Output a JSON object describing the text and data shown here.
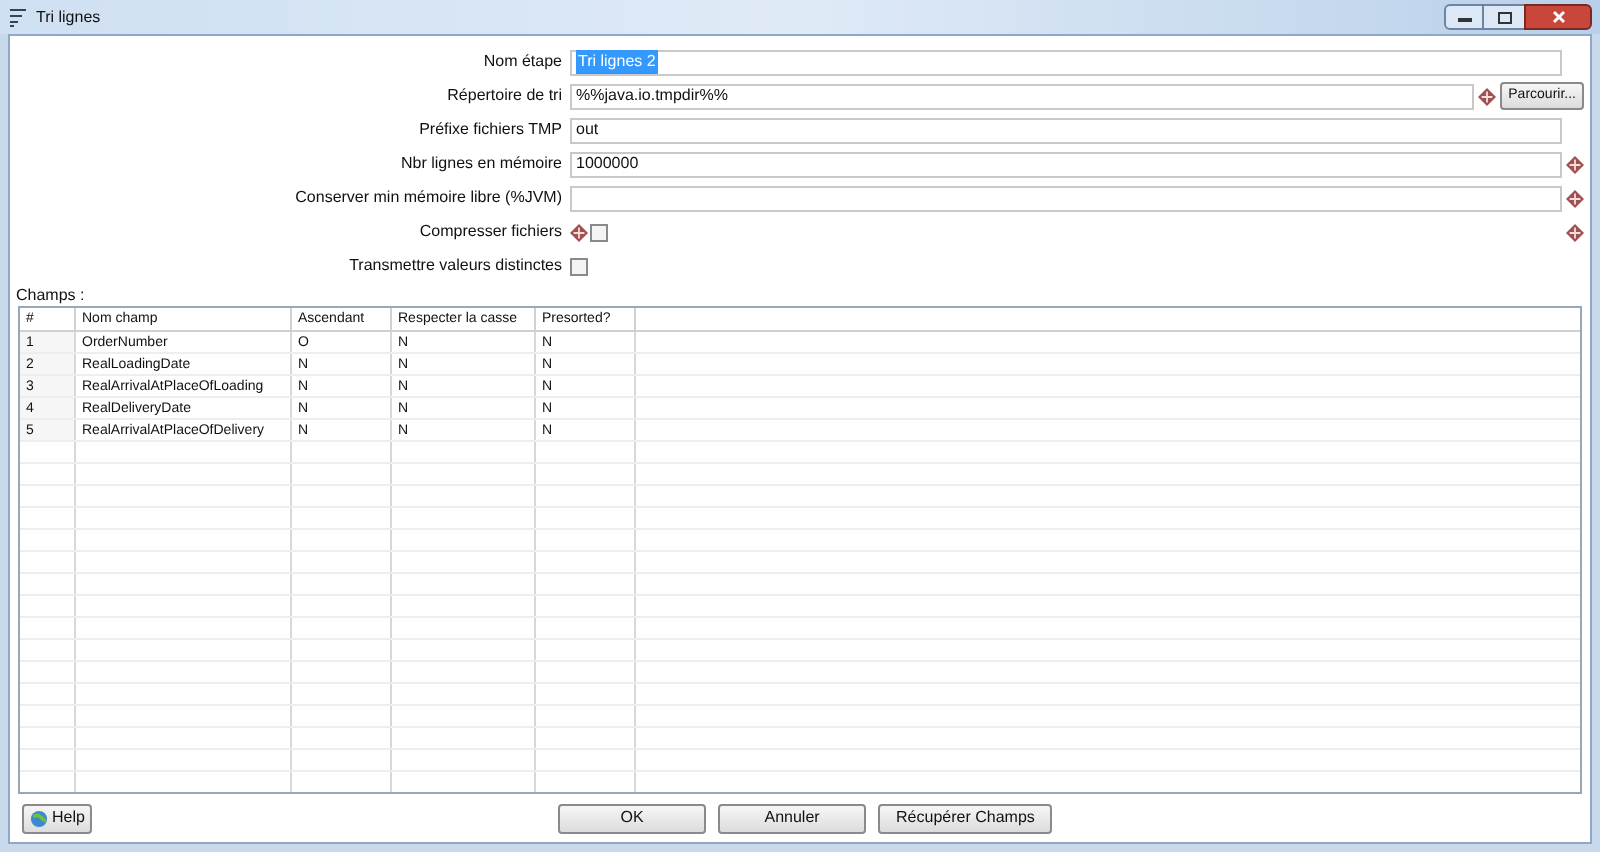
{
  "window": {
    "title": "Tri lignes"
  },
  "form": [
    {
      "kind": "text",
      "label": "Nom étape",
      "value": "Tri lignes 2",
      "text_selected": true,
      "variable": false
    },
    {
      "kind": "browse",
      "label": "Répertoire de tri",
      "value": "%%java.io.tmpdir%%",
      "variable": true,
      "button": "Parcourir..."
    },
    {
      "kind": "text",
      "label": "Préfixe fichiers TMP",
      "value": "out",
      "text_selected": false,
      "variable": false
    },
    {
      "kind": "text",
      "label": "Nbr lignes en mémoire",
      "value": "1000000",
      "text_selected": false,
      "variable": true
    },
    {
      "kind": "text",
      "label": "Conserver min mémoire libre (%JVM)",
      "variable": true
    },
    {
      "kind": "checkbox",
      "label": "Compresser fichiers",
      "checked": false,
      "variable": true
    },
    {
      "kind": "checkbox",
      "label": "Transmettre valeurs distinctes",
      "checked": false,
      "variable": false
    }
  ],
  "fields_label": "Champs :",
  "table": {
    "columns": [
      "#",
      "Nom champ",
      "Ascendant",
      "Respecter la casse",
      "Presorted?"
    ],
    "rows": [
      [
        "1",
        "OrderNumber",
        "O",
        "N",
        "N"
      ],
      [
        "2",
        "RealLoadingDate",
        "N",
        "N",
        "N"
      ],
      [
        "3",
        "RealArrivalAtPlaceOfLoading",
        "N",
        "N",
        "N"
      ],
      [
        "4",
        "RealDeliveryDate",
        "N",
        "N",
        "N"
      ],
      [
        "5",
        "RealArrivalAtPlaceOfDelivery",
        "N",
        "N",
        "N"
      ]
    ]
  },
  "help_button": "Help",
  "buttons": [
    "OK",
    "Annuler",
    "Récupérer Champs"
  ]
}
